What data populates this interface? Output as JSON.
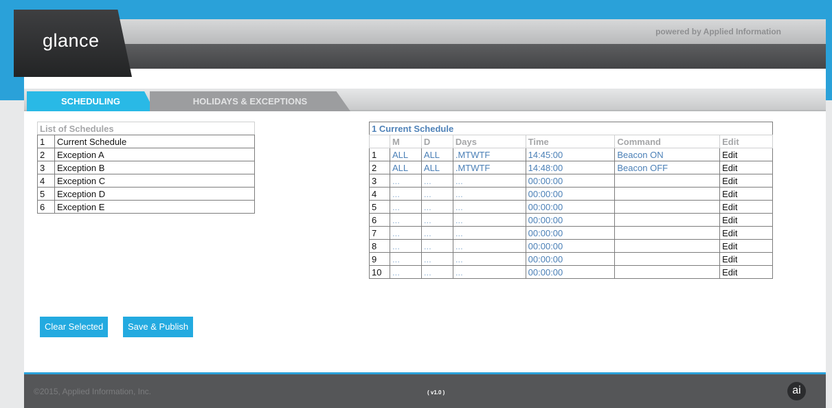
{
  "app": {
    "logo_text": "glance",
    "powered_by": "powered by Applied Information"
  },
  "tabs": [
    {
      "label": "SCHEDULING",
      "active": true
    },
    {
      "label": "HOLIDAYS & EXCEPTIONS",
      "active": false
    }
  ],
  "schedules_list": {
    "title": "List of Schedules",
    "items": [
      {
        "num": "1",
        "name": "Current Schedule"
      },
      {
        "num": "2",
        "name": "Exception A"
      },
      {
        "num": "3",
        "name": "Exception B"
      },
      {
        "num": "4",
        "name": "Exception C"
      },
      {
        "num": "5",
        "name": "Exception D"
      },
      {
        "num": "6",
        "name": "Exception E"
      }
    ]
  },
  "current_schedule": {
    "title": "1 Current Schedule",
    "columns": [
      "M",
      "D",
      "Days",
      "Time",
      "Command",
      "Edit"
    ],
    "rows": [
      {
        "num": "1",
        "m": "ALL",
        "d": "ALL",
        "days": ".MTWTF",
        "time": "14:45:00",
        "command": "Beacon ON",
        "edit": "Edit"
      },
      {
        "num": "2",
        "m": "ALL",
        "d": "ALL",
        "days": ".MTWTF",
        "time": "14:48:00",
        "command": "Beacon OFF",
        "edit": "Edit"
      },
      {
        "num": "3",
        "m": "...",
        "d": "...",
        "days": "...",
        "time": "00:00:00",
        "command": "",
        "edit": "Edit"
      },
      {
        "num": "4",
        "m": "...",
        "d": "...",
        "days": "...",
        "time": "00:00:00",
        "command": "",
        "edit": "Edit"
      },
      {
        "num": "5",
        "m": "...",
        "d": "...",
        "days": "...",
        "time": "00:00:00",
        "command": "",
        "edit": "Edit"
      },
      {
        "num": "6",
        "m": "...",
        "d": "...",
        "days": "...",
        "time": "00:00:00",
        "command": "",
        "edit": "Edit"
      },
      {
        "num": "7",
        "m": "...",
        "d": "...",
        "days": "...",
        "time": "00:00:00",
        "command": "",
        "edit": "Edit"
      },
      {
        "num": "8",
        "m": "...",
        "d": "...",
        "days": "...",
        "time": "00:00:00",
        "command": "",
        "edit": "Edit"
      },
      {
        "num": "9",
        "m": "...",
        "d": "...",
        "days": "...",
        "time": "00:00:00",
        "command": "",
        "edit": "Edit"
      },
      {
        "num": "10",
        "m": "...",
        "d": "...",
        "days": "...",
        "time": "00:00:00",
        "command": "",
        "edit": "Edit"
      }
    ]
  },
  "buttons": {
    "clear": "Clear Selected",
    "save": "Save & Publish"
  },
  "footer": {
    "copyright": "©2015, Applied Information, Inc.",
    "version": "( v1.0 )",
    "badge": "ai"
  },
  "colors": {
    "accent": "#2aa1d9",
    "tab_active": "#29b9e6",
    "button": "#23aae0",
    "footer_bg": "#555658"
  },
  "icons": {
    "footer_badge": "ai-logo-icon"
  }
}
